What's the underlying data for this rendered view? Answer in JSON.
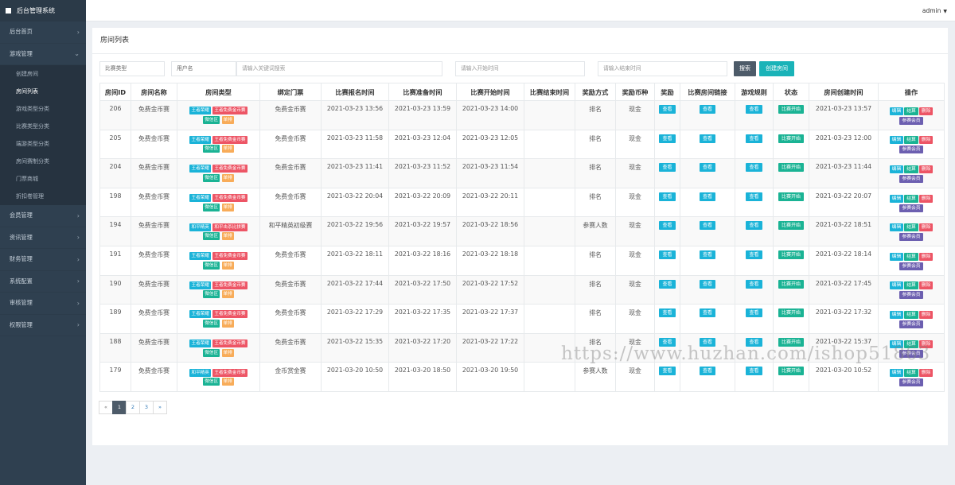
{
  "app": {
    "title": "后台管理系统",
    "user": "admin"
  },
  "sidebar": {
    "items": [
      {
        "label": "后台首页",
        "chev": "›"
      },
      {
        "label": "游戏管理",
        "chev": "⌄"
      },
      {
        "label": "会员管理",
        "chev": "›"
      },
      {
        "label": "资讯管理",
        "chev": "›"
      },
      {
        "label": "财务管理",
        "chev": "›"
      },
      {
        "label": "系统配置",
        "chev": "›"
      },
      {
        "label": "审核管理",
        "chev": "›"
      },
      {
        "label": "权限管理",
        "chev": "›"
      }
    ],
    "sub_items": [
      "创建房间",
      "房间列表",
      "游戏类型分类",
      "比赛类型分类",
      "端游类型分类",
      "房间赛制分类",
      "门票商城",
      "折扣卷管理"
    ]
  },
  "page": {
    "title": "房间列表"
  },
  "filters": {
    "match_type": "比赛类型",
    "username": "用户名",
    "keyword_placeholder": "请输入关键词搜索",
    "start_placeholder": "请输入开始时间",
    "end_placeholder": "请输入结束时间",
    "search_label": "搜索",
    "create_label": "创建房间"
  },
  "table": {
    "columns": [
      "房间ID",
      "房间名称",
      "房间类型",
      "绑定门票",
      "比赛报名时间",
      "比赛准备时间",
      "比赛开始时间",
      "比赛结束时间",
      "奖励方式",
      "奖励币种",
      "奖励",
      "比赛房间链接",
      "游戏规则",
      "状态",
      "房间创建时间",
      "操作"
    ],
    "view_label": "查看",
    "status_label": "比赛开始",
    "op_labels": {
      "edit": "编辑",
      "settle": "结算",
      "delete": "删除",
      "members": "参赛会员"
    },
    "rows": [
      {
        "id": "206",
        "name": "免费金币赛",
        "tags": [
          "王者荣耀",
          "王者免费金币赛",
          "微信区",
          "单排"
        ],
        "ticket": "免费金币赛",
        "signup": "2021-03-23 13:56",
        "prepare": "2021-03-23 13:59",
        "start": "2021-03-23 14:00",
        "end": "",
        "reward_method": "排名",
        "currency": "现金",
        "created": "2021-03-23 13:57"
      },
      {
        "id": "205",
        "name": "免费金币赛",
        "tags": [
          "王者荣耀",
          "王者免费金币赛",
          "微信区",
          "单排"
        ],
        "ticket": "免费金币赛",
        "signup": "2021-03-23 11:58",
        "prepare": "2021-03-23 12:04",
        "start": "2021-03-23 12:05",
        "end": "",
        "reward_method": "排名",
        "currency": "现金",
        "created": "2021-03-23 12:00"
      },
      {
        "id": "204",
        "name": "免费金币赛",
        "tags": [
          "王者荣耀",
          "王者免费金币赛",
          "微信区",
          "单排"
        ],
        "ticket": "免费金币赛",
        "signup": "2021-03-23 11:41",
        "prepare": "2021-03-23 11:52",
        "start": "2021-03-23 11:54",
        "end": "",
        "reward_method": "排名",
        "currency": "现金",
        "created": "2021-03-23 11:44"
      },
      {
        "id": "198",
        "name": "免费金币赛",
        "tags": [
          "王者荣耀",
          "王者免费金币赛",
          "微信区",
          "单排"
        ],
        "ticket": "免费金币赛",
        "signup": "2021-03-22 20:04",
        "prepare": "2021-03-22 20:09",
        "start": "2021-03-22 20:11",
        "end": "",
        "reward_method": "排名",
        "currency": "现金",
        "created": "2021-03-22 20:07"
      },
      {
        "id": "194",
        "name": "免费金币赛",
        "tags": [
          "和平精英",
          "和平击杀比拼赛",
          "微信区",
          "单排"
        ],
        "ticket": "和平精英初级赛",
        "signup": "2021-03-22 19:56",
        "prepare": "2021-03-22 19:57",
        "start": "2021-03-22 18:56",
        "end": "",
        "reward_method": "参赛人数",
        "currency": "现金",
        "created": "2021-03-22 18:51"
      },
      {
        "id": "191",
        "name": "免费金币赛",
        "tags": [
          "王者荣耀",
          "王者免费金币赛",
          "微信区",
          "单排"
        ],
        "ticket": "免费金币赛",
        "signup": "2021-03-22 18:11",
        "prepare": "2021-03-22 18:16",
        "start": "2021-03-22 18:18",
        "end": "",
        "reward_method": "排名",
        "currency": "现金",
        "created": "2021-03-22 18:14"
      },
      {
        "id": "190",
        "name": "免费金币赛",
        "tags": [
          "王者荣耀",
          "王者免费金币赛",
          "微信区",
          "单排"
        ],
        "ticket": "免费金币赛",
        "signup": "2021-03-22 17:44",
        "prepare": "2021-03-22 17:50",
        "start": "2021-03-22 17:52",
        "end": "",
        "reward_method": "排名",
        "currency": "现金",
        "created": "2021-03-22 17:45"
      },
      {
        "id": "189",
        "name": "免费金币赛",
        "tags": [
          "王者荣耀",
          "王者免费金币赛",
          "微信区",
          "单排"
        ],
        "ticket": "免费金币赛",
        "signup": "2021-03-22 17:29",
        "prepare": "2021-03-22 17:35",
        "start": "2021-03-22 17:37",
        "end": "",
        "reward_method": "排名",
        "currency": "现金",
        "created": "2021-03-22 17:32"
      },
      {
        "id": "188",
        "name": "免费金币赛",
        "tags": [
          "王者荣耀",
          "王者免费金币赛",
          "微信区",
          "单排"
        ],
        "ticket": "免费金币赛",
        "signup": "2021-03-22 15:35",
        "prepare": "2021-03-22 17:20",
        "start": "2021-03-22 17:22",
        "end": "",
        "reward_method": "排名",
        "currency": "现金",
        "created": "2021-03-22 15:37"
      },
      {
        "id": "179",
        "name": "免费金币赛",
        "tags": [
          "和平精英",
          "王者免费金币赛",
          "微信区",
          "单排"
        ],
        "ticket": "金币赏金赛",
        "signup": "2021-03-20 10:50",
        "prepare": "2021-03-20 18:50",
        "start": "2021-03-20 19:50",
        "end": "",
        "reward_method": "参赛人数",
        "currency": "现金",
        "created": "2021-03-20 10:52"
      }
    ]
  },
  "pagination": {
    "prev": "«",
    "pages": [
      "1",
      "2",
      "3"
    ],
    "next": "»",
    "current": "1"
  },
  "watermark": "https://www.huzhan.com/ishop51863",
  "colors": {
    "sidebar": "#2f4050",
    "accent": "#1ab3b8",
    "danger": "#ed5565",
    "success": "#1ab394",
    "warning": "#f8ac59",
    "purple": "#6c5fb0"
  }
}
